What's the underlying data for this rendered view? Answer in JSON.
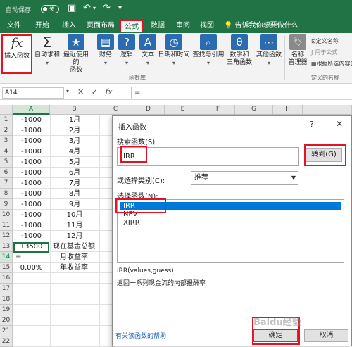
{
  "colors": {
    "excel_green": "#217346",
    "selection_blue": "#0078d7",
    "highlight_red": "#e81123"
  },
  "title_bar": {
    "autosave": "自动保存",
    "toggle": "关"
  },
  "tabs": [
    "文件",
    "开始",
    "插入",
    "页面布局",
    "公式",
    "数据",
    "审阅",
    "视图"
  ],
  "tell_me": "告诉我你想要做什么",
  "ribbon": {
    "insert_function": "插入函数",
    "autosum": "自动求和",
    "recent": [
      "最近使用的",
      "函数"
    ],
    "financial": "财务",
    "logical": "逻辑",
    "text": "文本",
    "datetime": "日期和时间",
    "lookup": "查找与引用",
    "math": [
      "数学和",
      "三角函数"
    ],
    "more": "其他函数",
    "name_manager": [
      "名称",
      "管理器"
    ],
    "define_name": "定义名称",
    "use_in_formula": "用于公式",
    "create_from_selection": "根据所选内容创建",
    "group_library": "函数库",
    "group_names": "定义的名称"
  },
  "formula_bar": {
    "namebox": "A14",
    "fx": "fx",
    "formula": "="
  },
  "sheet": {
    "columns": [
      "A",
      "B",
      "C",
      "D",
      "E",
      "F",
      "G",
      "H",
      "I"
    ],
    "rows": [
      "1",
      "2",
      "3",
      "4",
      "5",
      "6",
      "7",
      "8",
      "9",
      "10",
      "11",
      "12",
      "13",
      "14",
      "15",
      "16",
      "17",
      "18",
      "19",
      "20",
      "21",
      "22"
    ],
    "colA": [
      "-1000",
      "-1000",
      "-1000",
      "-1000",
      "-1000",
      "-1000",
      "-1000",
      "-1000",
      "-1000",
      "-1000",
      "-1000",
      "-1000",
      "13500",
      "=",
      "0.00%"
    ],
    "colB": [
      "1月",
      "2月",
      "3月",
      "4月",
      "5月",
      "6月",
      "7月",
      "8月",
      "9月",
      "10月",
      "11月",
      "12月",
      "现在基金总额",
      "月收益率",
      "年收益率"
    ]
  },
  "dialog": {
    "title": "插入函数",
    "help": "?",
    "close": "✕",
    "search_label": "搜索函数(S):",
    "search_value": "IRR",
    "go_button": "转到(G)",
    "category_label": "或选择类别(C):",
    "category_value": "推荐",
    "select_label": "选择函数(N):",
    "functions": [
      "IRR",
      "NPV",
      "XIRR"
    ],
    "signature": "IRR(values,guess)",
    "description": "返回一系列现金流的内部报酬率",
    "help_link": "有关该函数的帮助",
    "ok": "确定",
    "cancel": "取消"
  },
  "watermark": "Baidu经验"
}
